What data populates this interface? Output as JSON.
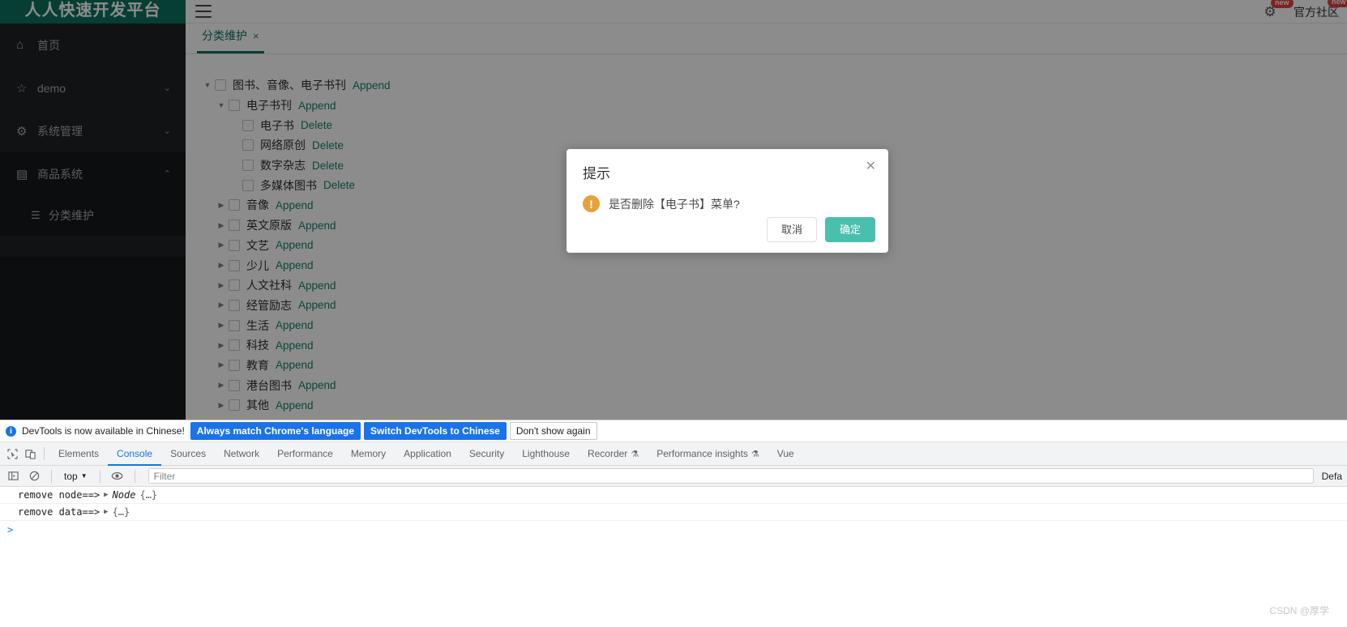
{
  "app": {
    "logo_text": "人人快速开发平台",
    "topbar": {
      "menu_icon": "hamburger-icon",
      "gear_icon": "gear-icon",
      "gear_badge": "new",
      "community_label": "官方社区",
      "community_badge": "new"
    },
    "sidebar": {
      "items": [
        {
          "label": "首页",
          "icon": "home-icon",
          "chevron": "",
          "expanded": false
        },
        {
          "label": "demo",
          "icon": "star-icon",
          "chevron": "⌄",
          "expanded": false
        },
        {
          "label": "系统管理",
          "icon": "gear-icon",
          "chevron": "⌄",
          "expanded": false
        },
        {
          "label": "商品系统",
          "icon": "product-icon",
          "chevron": "⌃",
          "expanded": true
        }
      ],
      "sub_items": [
        {
          "label": "分类维护",
          "icon": "list-icon"
        }
      ]
    },
    "tabs": [
      {
        "label": "分类维护",
        "close": "×",
        "active": true
      }
    ],
    "tree": [
      {
        "depth": 0,
        "arrow": "▼",
        "label": "图书、音像、电子书刊",
        "action": "Append"
      },
      {
        "depth": 1,
        "arrow": "▼",
        "label": "电子书刊",
        "action": "Append"
      },
      {
        "depth": 2,
        "arrow": "",
        "label": "电子书",
        "action": "Delete"
      },
      {
        "depth": 2,
        "arrow": "",
        "label": "网络原创",
        "action": "Delete"
      },
      {
        "depth": 2,
        "arrow": "",
        "label": "数字杂志",
        "action": "Delete"
      },
      {
        "depth": 2,
        "arrow": "",
        "label": "多媒体图书",
        "action": "Delete"
      },
      {
        "depth": 1,
        "arrow": "▶",
        "label": "音像",
        "action": "Append"
      },
      {
        "depth": 1,
        "arrow": "▶",
        "label": "英文原版",
        "action": "Append"
      },
      {
        "depth": 1,
        "arrow": "▶",
        "label": "文艺",
        "action": "Append"
      },
      {
        "depth": 1,
        "arrow": "▶",
        "label": "少儿",
        "action": "Append"
      },
      {
        "depth": 1,
        "arrow": "▶",
        "label": "人文社科",
        "action": "Append"
      },
      {
        "depth": 1,
        "arrow": "▶",
        "label": "经管励志",
        "action": "Append"
      },
      {
        "depth": 1,
        "arrow": "▶",
        "label": "生活",
        "action": "Append"
      },
      {
        "depth": 1,
        "arrow": "▶",
        "label": "科技",
        "action": "Append"
      },
      {
        "depth": 1,
        "arrow": "▶",
        "label": "教育",
        "action": "Append"
      },
      {
        "depth": 1,
        "arrow": "▶",
        "label": "港台图书",
        "action": "Append"
      },
      {
        "depth": 1,
        "arrow": "▶",
        "label": "其他",
        "action": "Append"
      }
    ]
  },
  "modal": {
    "title": "提示",
    "close_icon": "close-icon",
    "warn_icon": "warning-icon",
    "warn_glyph": "!",
    "message": "是否删除【电子书】菜单?",
    "cancel_label": "取消",
    "confirm_label": "确定",
    "confirm_color": "#49c0ae"
  },
  "devtools": {
    "notice": {
      "info_glyph": "i",
      "text": "DevTools is now available in Chinese!",
      "buttons": [
        {
          "label": "Always match Chrome's language",
          "style": "blue"
        },
        {
          "label": "Switch DevTools to Chinese",
          "style": "blue"
        },
        {
          "label": "Don't show again",
          "style": "white"
        }
      ]
    },
    "tools": [
      {
        "icon": "inspect-element-icon"
      },
      {
        "icon": "device-toolbar-icon"
      }
    ],
    "tabs": [
      {
        "label": "Elements",
        "selected": false,
        "badge": ""
      },
      {
        "label": "Console",
        "selected": true,
        "badge": ""
      },
      {
        "label": "Sources",
        "selected": false,
        "badge": ""
      },
      {
        "label": "Network",
        "selected": false,
        "badge": ""
      },
      {
        "label": "Performance",
        "selected": false,
        "badge": ""
      },
      {
        "label": "Memory",
        "selected": false,
        "badge": ""
      },
      {
        "label": "Application",
        "selected": false,
        "badge": ""
      },
      {
        "label": "Security",
        "selected": false,
        "badge": ""
      },
      {
        "label": "Lighthouse",
        "selected": false,
        "badge": ""
      },
      {
        "label": "Recorder",
        "selected": false,
        "badge": "⚗"
      },
      {
        "label": "Performance insights",
        "selected": false,
        "badge": "⚗"
      },
      {
        "label": "Vue",
        "selected": false,
        "badge": ""
      }
    ],
    "console_bar": {
      "sidebar_icon": "console-sidebar-icon",
      "clear_icon": "clear-console-icon",
      "context_label": "top",
      "context_caret": "▼",
      "eye_icon": "live-expression-icon",
      "filter_placeholder": "Filter",
      "levels_label": "Defa"
    },
    "console_output": [
      {
        "text": "remove node==>",
        "arrow": "▶",
        "obj_name": "Node",
        "obj_brace": "{…}"
      },
      {
        "text": "remove data==>",
        "arrow": "▶",
        "obj_name": "",
        "obj_brace": "{…}"
      }
    ],
    "prompt": ">"
  },
  "watermark": "CSDN @厚学"
}
